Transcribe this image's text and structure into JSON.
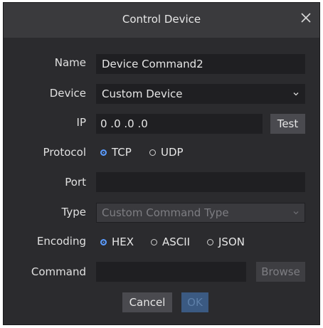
{
  "dialog": {
    "title": "Control Device",
    "close_icon": "close-icon"
  },
  "form": {
    "name": {
      "label": "Name",
      "value": "Device Command2"
    },
    "device": {
      "label": "Device",
      "value": "Custom Device"
    },
    "ip": {
      "label": "IP",
      "value": "0 .0 .0 .0",
      "test_label": "Test"
    },
    "protocol": {
      "label": "Protocol",
      "options": [
        "TCP",
        "UDP"
      ],
      "selected": "TCP"
    },
    "port": {
      "label": "Port",
      "value": ""
    },
    "type": {
      "label": "Type",
      "value": "Custom Command Type",
      "disabled": true
    },
    "encoding": {
      "label": "Encoding",
      "options": [
        "HEX",
        "ASCII",
        "JSON"
      ],
      "selected": "HEX"
    },
    "command": {
      "label": "Command",
      "value": "",
      "browse_label": "Browse"
    }
  },
  "footer": {
    "cancel_label": "Cancel",
    "ok_label": "OK"
  },
  "colors": {
    "accent": "#5b9cff",
    "background": "#2b2b2e",
    "titlebar": "#3a3a3d"
  }
}
